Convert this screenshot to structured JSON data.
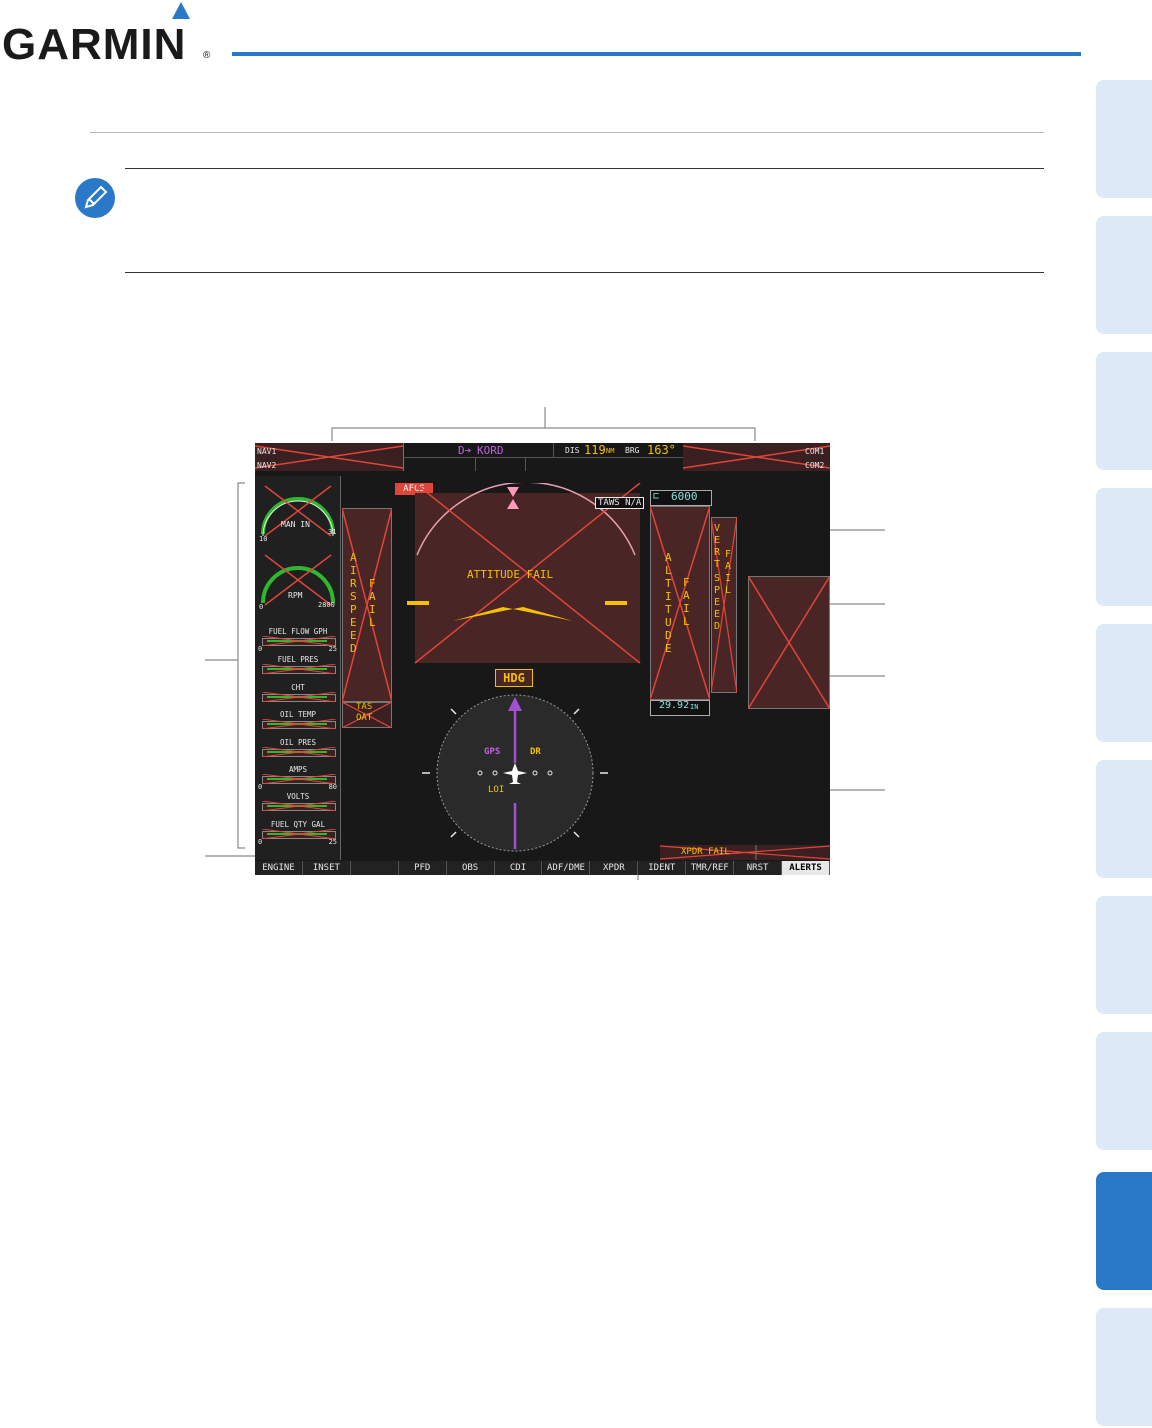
{
  "brand": {
    "name": "GARMIN",
    "registered": "®",
    "accent": "#2a78c8"
  },
  "screen": {
    "top_bar": {
      "nav1": "NAV1",
      "nav2": "NAV2",
      "com1": "COM1",
      "com2": "COM2",
      "waypoint": "KORD",
      "dis_label": "DIS",
      "dis_value": "119",
      "dis_unit": "NM",
      "brg_label": "BRG",
      "brg_value": "163°"
    },
    "flags": {
      "afcs": "AFCS",
      "taws": "TAWS N/A",
      "attitude": "ATTITUDE FAIL",
      "hdg": "HDG",
      "xpdr": "XPDR FAIL",
      "gps": "GPS",
      "dr": "DR",
      "loi": "LOI"
    },
    "airspeed": {
      "label": "AIRSPEED",
      "fail": "FAIL",
      "tas": "TAS",
      "oat": "OAT"
    },
    "altitude": {
      "selected": "6000",
      "label": "ALTITUDE",
      "fail": "FAIL",
      "baro": "29.92",
      "baro_unit": "IN"
    },
    "vspeed": {
      "label_a": "VERT",
      "label_b": "SPEED",
      "fail": "FAIL"
    },
    "engine": {
      "man_in": {
        "label": "MAN IN",
        "min": "10",
        "max": "31"
      },
      "rpm": {
        "label": "RPM",
        "min": "0",
        "max": "2800"
      },
      "bars": [
        {
          "label": "FUEL FLOW GPH",
          "min": "0",
          "max": "25"
        },
        {
          "label": "FUEL PRES",
          "min": "",
          "max": ""
        },
        {
          "label": "CHT",
          "min": "",
          "max": ""
        },
        {
          "label": "OIL TEMP",
          "min": "",
          "max": ""
        },
        {
          "label": "OIL PRES",
          "min": "",
          "max": ""
        },
        {
          "label": "AMPS",
          "min": "0",
          "max": "80"
        },
        {
          "label": "VOLTS",
          "min": "",
          "max": ""
        },
        {
          "label": "FUEL QTY GAL",
          "min": "0",
          "max": "25"
        }
      ]
    },
    "softkeys": [
      "ENGINE",
      "INSET",
      "",
      "PFD",
      "OBS",
      "CDI",
      "ADF/DME",
      "XPDR",
      "IDENT",
      "TMR/REF",
      "NRST",
      "ALERTS"
    ],
    "active_softkey": "ALERTS"
  },
  "colors": {
    "fail_red": "#e0453a",
    "amber": "#f5c000",
    "magenta": "#c060e0",
    "cyan": "#88e0e0",
    "tab_light": "#dde9f6",
    "tab_active": "#2a78c8"
  }
}
